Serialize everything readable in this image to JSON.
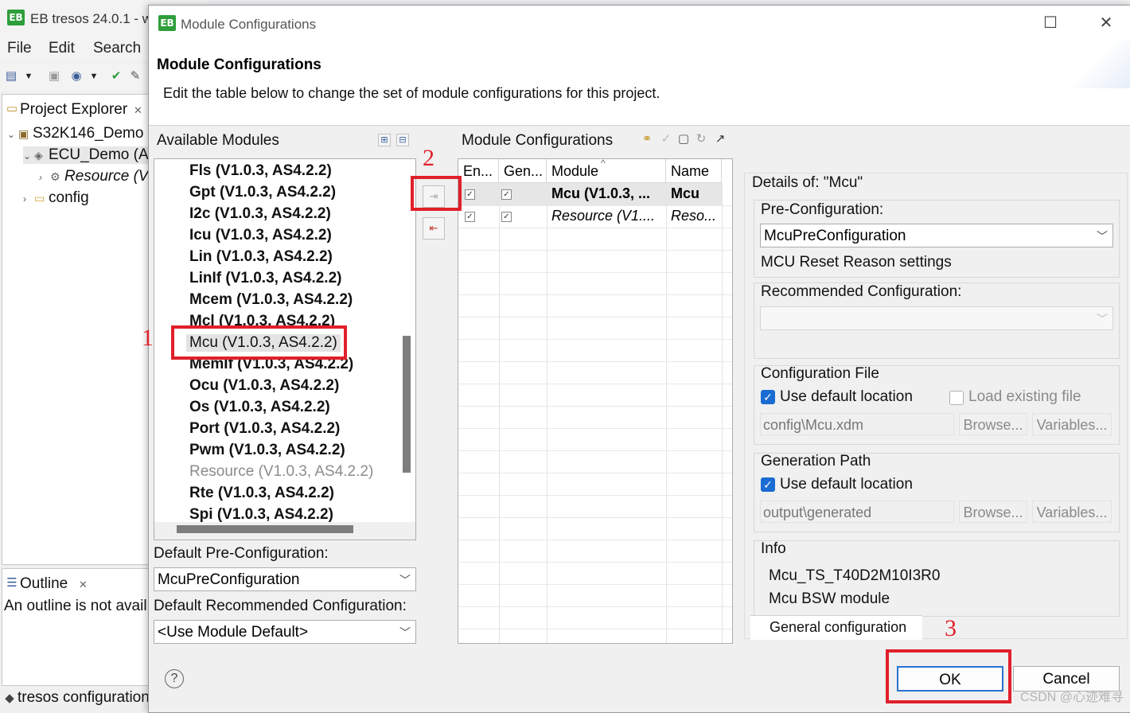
{
  "app": {
    "title": "EB tresos 24.0.1 - w",
    "logo_text": "EB",
    "menu": [
      "File",
      "Edit",
      "Search"
    ],
    "project_explorer": {
      "tab_label": "Project Explorer",
      "tree": [
        {
          "label": "S32K146_Demo",
          "italic": false
        },
        {
          "label": "ECU_Demo (A",
          "italic": false
        },
        {
          "label": "Resource (V",
          "italic": true
        },
        {
          "label": "config",
          "italic": false
        }
      ]
    },
    "outline": {
      "tab_label": "Outline",
      "message": "An outline is not avail"
    },
    "status_text": "tresos configuration"
  },
  "dialog": {
    "title": "Module Configurations",
    "heading": "Module Configurations",
    "description": "Edit the table below to change the set of module configurations for this project.",
    "available_modules": {
      "label": "Available Modules",
      "items": [
        {
          "label": "Fls (V1.0.3, AS4.2.2)",
          "state": "bold"
        },
        {
          "label": "Gpt (V1.0.3, AS4.2.2)",
          "state": "bold"
        },
        {
          "label": "I2c (V1.0.3, AS4.2.2)",
          "state": "bold"
        },
        {
          "label": "Icu (V1.0.3, AS4.2.2)",
          "state": "bold"
        },
        {
          "label": "Lin (V1.0.3, AS4.2.2)",
          "state": "bold"
        },
        {
          "label": "LinIf (V1.0.3, AS4.2.2)",
          "state": "bold"
        },
        {
          "label": "Mcem (V1.0.3, AS4.2.2)",
          "state": "bold"
        },
        {
          "label": "Mcl (V1.0.3, AS4.2.2)",
          "state": "bold"
        },
        {
          "label": "Mcu (V1.0.3, AS4.2.2)",
          "state": "selected"
        },
        {
          "label": "MemIf (V1.0.3, AS4.2.2)",
          "state": "bold"
        },
        {
          "label": "Ocu (V1.0.3, AS4.2.2)",
          "state": "bold"
        },
        {
          "label": "Os (V1.0.3, AS4.2.2)",
          "state": "bold"
        },
        {
          "label": "Port (V1.0.3, AS4.2.2)",
          "state": "bold"
        },
        {
          "label": "Pwm (V1.0.3, AS4.2.2)",
          "state": "bold"
        },
        {
          "label": "Resource (V1.0.3, AS4.2.2)",
          "state": "disabled"
        },
        {
          "label": "Rte (V1.0.3, AS4.2.2)",
          "state": "bold"
        },
        {
          "label": "Spi (V1.0.3, AS4.2.2)",
          "state": "bold"
        }
      ]
    },
    "default_preconfig": {
      "label": "Default Pre-Configuration:",
      "value": "McuPreConfiguration"
    },
    "default_recommended": {
      "label": "Default Recommended Configuration:",
      "value": "<Use Module Default>"
    },
    "module_configurations": {
      "label": "Module Configurations",
      "columns": [
        "En...",
        "Gen...",
        "Module",
        "Name"
      ],
      "rows": [
        {
          "module": "Mcu (V1.0.3, ...",
          "name": "Mcu",
          "enabled": true,
          "generate": true,
          "italic": false
        },
        {
          "module": "Resource (V1....",
          "name": "Reso...",
          "enabled": true,
          "generate": true,
          "italic": true
        }
      ]
    },
    "details": {
      "title": "Details of: \"Mcu\"",
      "pre_config": {
        "label": "Pre-Configuration:",
        "value": "McuPreConfiguration",
        "description": "MCU Reset Reason settings"
      },
      "recommended": {
        "label": "Recommended Configuration:",
        "value": ""
      },
      "config_file": {
        "label": "Configuration File",
        "use_default": "Use default location",
        "load_existing": "Load existing file",
        "path": "config\\Mcu.xdm",
        "browse": "Browse...",
        "variables": "Variables..."
      },
      "generation_path": {
        "label": "Generation Path",
        "use_default": "Use default location",
        "path": "output\\generated",
        "browse": "Browse...",
        "variables": "Variables..."
      },
      "info": {
        "label": "Info",
        "lines": [
          "Mcu_TS_T40D2M10I3R0",
          "Mcu BSW module"
        ]
      },
      "tab": "General configuration"
    },
    "buttons": {
      "ok": "OK",
      "cancel": "Cancel",
      "help": "?"
    }
  },
  "annotations": [
    "1",
    "2",
    "3"
  ],
  "watermark": "CSDN @心迹难寻",
  "colors": {
    "annotation": "#e0202a",
    "checkbox": "#1a6cd2",
    "logo": "#2e9e3a"
  }
}
